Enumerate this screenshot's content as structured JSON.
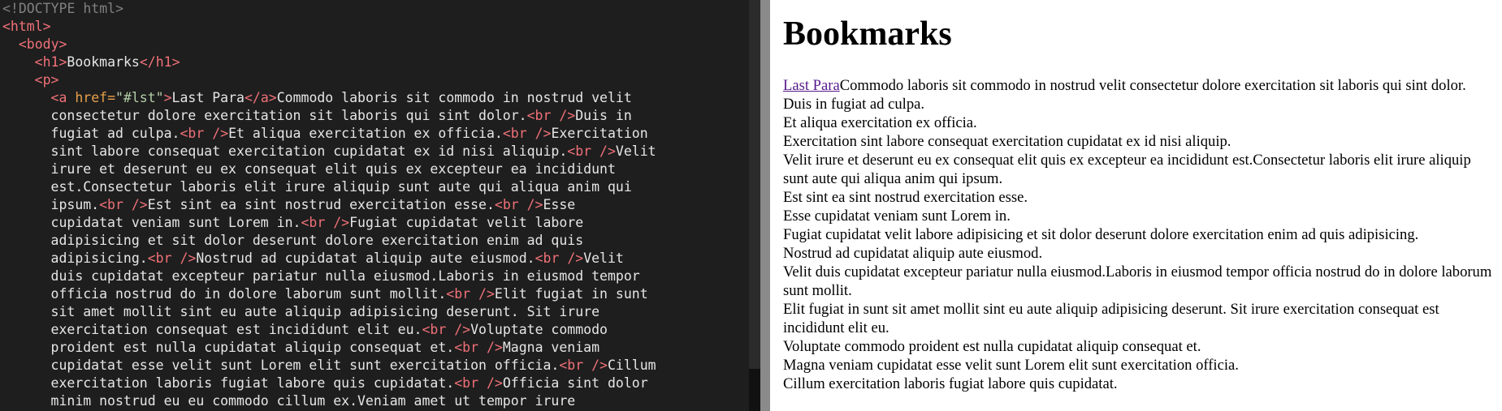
{
  "editor": {
    "lines": [
      {
        "indent": 0,
        "tokens": [
          {
            "t": "doctype",
            "v": "<!DOCTYPE html>"
          }
        ]
      },
      {
        "indent": 0,
        "tokens": [
          {
            "t": "tag",
            "v": "<html>"
          }
        ]
      },
      {
        "indent": 2,
        "tokens": [
          {
            "t": "tag",
            "v": "<body>"
          }
        ]
      },
      {
        "indent": 4,
        "tokens": [
          {
            "t": "tag",
            "v": "<h1>"
          },
          {
            "t": "text",
            "v": "Bookmarks"
          },
          {
            "t": "tag",
            "v": "</h1>"
          }
        ]
      },
      {
        "indent": 4,
        "tokens": [
          {
            "t": "tag",
            "v": "<p>"
          }
        ]
      },
      {
        "indent": 6,
        "tokens": [
          {
            "t": "tag",
            "v": "<a "
          },
          {
            "t": "attr",
            "v": "href="
          },
          {
            "t": "str",
            "v": "\"#lst\""
          },
          {
            "t": "tag",
            "v": ">"
          },
          {
            "t": "text",
            "v": "Last Para"
          },
          {
            "t": "tag",
            "v": "</a>"
          },
          {
            "t": "text",
            "v": "Commodo laboris sit commodo in nostrud velit"
          }
        ]
      },
      {
        "indent": 6,
        "tokens": [
          {
            "t": "text",
            "v": "consectetur dolore exercitation sit laboris qui sint dolor."
          },
          {
            "t": "tag",
            "v": "<br />"
          },
          {
            "t": "text",
            "v": "Duis in"
          }
        ]
      },
      {
        "indent": 6,
        "tokens": [
          {
            "t": "text",
            "v": "fugiat ad culpa."
          },
          {
            "t": "tag",
            "v": "<br />"
          },
          {
            "t": "text",
            "v": "Et aliqua exercitation ex officia."
          },
          {
            "t": "tag",
            "v": "<br />"
          },
          {
            "t": "text",
            "v": "Exercitation"
          }
        ]
      },
      {
        "indent": 6,
        "tokens": [
          {
            "t": "text",
            "v": "sint labore consequat exercitation cupidatat ex id nisi aliquip."
          },
          {
            "t": "tag",
            "v": "<br />"
          },
          {
            "t": "text",
            "v": "Velit"
          }
        ]
      },
      {
        "indent": 6,
        "tokens": [
          {
            "t": "text",
            "v": "irure et deserunt eu ex consequat elit quis ex excepteur ea incididunt"
          }
        ]
      },
      {
        "indent": 6,
        "tokens": [
          {
            "t": "text",
            "v": "est.Consectetur laboris elit irure aliquip sunt aute qui aliqua anim qui"
          }
        ]
      },
      {
        "indent": 6,
        "tokens": [
          {
            "t": "text",
            "v": "ipsum."
          },
          {
            "t": "tag",
            "v": "<br />"
          },
          {
            "t": "text",
            "v": "Est sint ea sint nostrud exercitation esse."
          },
          {
            "t": "tag",
            "v": "<br />"
          },
          {
            "t": "text",
            "v": "Esse"
          }
        ]
      },
      {
        "indent": 6,
        "tokens": [
          {
            "t": "text",
            "v": "cupidatat veniam sunt Lorem in."
          },
          {
            "t": "tag",
            "v": "<br />"
          },
          {
            "t": "text",
            "v": "Fugiat cupidatat velit labore"
          }
        ]
      },
      {
        "indent": 6,
        "tokens": [
          {
            "t": "text",
            "v": "adipisicing et sit dolor deserunt dolore exercitation enim ad quis"
          }
        ]
      },
      {
        "indent": 6,
        "tokens": [
          {
            "t": "text",
            "v": "adipisicing."
          },
          {
            "t": "tag",
            "v": "<br />"
          },
          {
            "t": "text",
            "v": "Nostrud ad cupidatat aliquip aute eiusmod."
          },
          {
            "t": "tag",
            "v": "<br />"
          },
          {
            "t": "text",
            "v": "Velit"
          }
        ]
      },
      {
        "indent": 6,
        "tokens": [
          {
            "t": "text",
            "v": "duis cupidatat excepteur pariatur nulla eiusmod.Laboris in eiusmod tempor"
          }
        ]
      },
      {
        "indent": 6,
        "tokens": [
          {
            "t": "text",
            "v": "officia nostrud do in dolore laborum sunt mollit."
          },
          {
            "t": "tag",
            "v": "<br />"
          },
          {
            "t": "text",
            "v": "Elit fugiat in sunt"
          }
        ]
      },
      {
        "indent": 6,
        "tokens": [
          {
            "t": "text",
            "v": "sit amet mollit sint eu aute aliquip adipisicing deserunt. Sit irure"
          }
        ]
      },
      {
        "indent": 6,
        "tokens": [
          {
            "t": "text",
            "v": "exercitation consequat est incididunt elit eu."
          },
          {
            "t": "tag",
            "v": "<br />"
          },
          {
            "t": "text",
            "v": "Voluptate commodo"
          }
        ]
      },
      {
        "indent": 6,
        "tokens": [
          {
            "t": "text",
            "v": "proident est nulla cupidatat aliquip consequat et."
          },
          {
            "t": "tag",
            "v": "<br />"
          },
          {
            "t": "text",
            "v": "Magna veniam"
          }
        ]
      },
      {
        "indent": 6,
        "tokens": [
          {
            "t": "text",
            "v": "cupidatat esse velit sunt Lorem elit sunt exercitation officia."
          },
          {
            "t": "tag",
            "v": "<br />"
          },
          {
            "t": "text",
            "v": "Cillum"
          }
        ]
      },
      {
        "indent": 6,
        "tokens": [
          {
            "t": "text",
            "v": "exercitation laboris fugiat labore quis cupidatat."
          },
          {
            "t": "tag",
            "v": "<br />"
          },
          {
            "t": "text",
            "v": "Officia sint dolor"
          }
        ]
      },
      {
        "indent": 6,
        "tokens": [
          {
            "t": "text",
            "v": "minim nostrud eu eu commodo cillum ex.Veniam amet ut tempor irure"
          }
        ]
      }
    ]
  },
  "preview": {
    "heading": "Bookmarks",
    "link_text": "Last Para",
    "link_href": "#lst",
    "lines": [
      "Commodo laboris sit commodo in nostrud velit consectetur dolore exercitation sit laboris qui sint dolor.",
      "Duis in fugiat ad culpa.",
      "Et aliqua exercitation ex officia.",
      "Exercitation sint labore consequat exercitation cupidatat ex id nisi aliquip.",
      "Velit irure et deserunt eu ex consequat elit quis ex excepteur ea incididunt est.Consectetur laboris elit irure aliquip sunt aute qui aliqua anim qui ipsum.",
      "Est sint ea sint nostrud exercitation esse.",
      "Esse cupidatat veniam sunt Lorem in.",
      "Fugiat cupidatat velit labore adipisicing et sit dolor deserunt dolore exercitation enim ad quis adipisicing.",
      "Nostrud ad cupidatat aliquip aute eiusmod.",
      "Velit duis cupidatat excepteur pariatur nulla eiusmod.Laboris in eiusmod tempor officia nostrud do in dolore laborum sunt mollit.",
      "Elit fugiat in sunt sit amet mollit sint eu aute aliquip adipisicing deserunt. Sit irure exercitation consequat est incididunt elit eu.",
      "Voluptate commodo proident est nulla cupidatat aliquip consequat et.",
      "Magna veniam cupidatat esse velit sunt Lorem elit sunt exercitation officia.",
      "Cillum exercitation laboris fugiat labore quis cupidatat."
    ]
  },
  "colors": {
    "editor_bg": "#1e1e1e",
    "tag": "#f07178",
    "attr": "#e8a04a",
    "string": "#b5cea8",
    "link_visited": "#551a8b"
  }
}
